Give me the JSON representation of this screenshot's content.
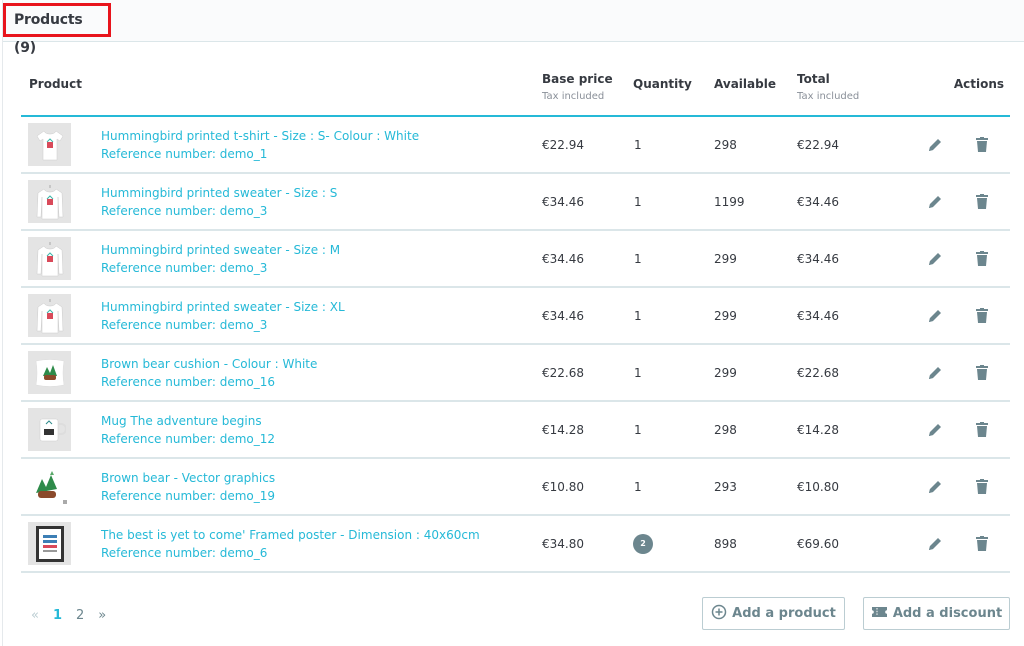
{
  "card": {
    "title": "Products (9)"
  },
  "table": {
    "headers": {
      "product": "Product",
      "base_price": "Base price",
      "base_price_sub": "Tax included",
      "quantity": "Quantity",
      "available": "Available",
      "total": "Total",
      "total_sub": "Tax included",
      "actions": "Actions"
    },
    "rows": [
      {
        "name": "Hummingbird printed t-shirt - Size : S- Colour : White",
        "reference": "Reference number: demo_1",
        "image": "t-shirt",
        "base_price": "€22.94",
        "quantity": "1",
        "available": "298",
        "total": "€22.94"
      },
      {
        "name": "Hummingbird printed sweater - Size : S",
        "reference": "Reference number: demo_3",
        "image": "sweater",
        "base_price": "€34.46",
        "quantity": "1",
        "available": "1199",
        "total": "€34.46"
      },
      {
        "name": "Hummingbird printed sweater - Size : M",
        "reference": "Reference number: demo_3",
        "image": "sweater",
        "base_price": "€34.46",
        "quantity": "1",
        "available": "299",
        "total": "€34.46"
      },
      {
        "name": "Hummingbird printed sweater - Size : XL",
        "reference": "Reference number: demo_3",
        "image": "sweater",
        "base_price": "€34.46",
        "quantity": "1",
        "available": "299",
        "total": "€34.46"
      },
      {
        "name": "Brown bear cushion - Colour : White",
        "reference": "Reference number: demo_16",
        "image": "cushion",
        "base_price": "€22.68",
        "quantity": "1",
        "available": "299",
        "total": "€22.68"
      },
      {
        "name": "Mug The adventure begins",
        "reference": "Reference number: demo_12",
        "image": "mug",
        "base_price": "€14.28",
        "quantity": "1",
        "available": "298",
        "total": "€14.28"
      },
      {
        "name": "Brown bear - Vector graphics",
        "reference": "Reference number: demo_19",
        "image": "vector-graphics",
        "base_price": "€10.80",
        "quantity": "1",
        "available": "293",
        "total": "€10.80"
      },
      {
        "name": "The best is yet to come' Framed poster - Dimension : 40x60cm",
        "reference": "Reference number: demo_6",
        "image": "framed-poster",
        "base_price": "€34.80",
        "quantity": "2",
        "quantity_badge": true,
        "available": "898",
        "total": "€69.60"
      }
    ],
    "row_actions": [
      "edit-icon",
      "delete-icon"
    ]
  },
  "pagination": {
    "prev": "«",
    "pages": [
      "1",
      "2"
    ],
    "current": "1",
    "next": "»"
  },
  "buttons": {
    "add_product": "Add a product",
    "add_discount": "Add a discount"
  },
  "colors": {
    "accent": "#25b9d7",
    "highlight_border": "#e8141c",
    "icon": "#6c868e",
    "text": "#363a41"
  }
}
